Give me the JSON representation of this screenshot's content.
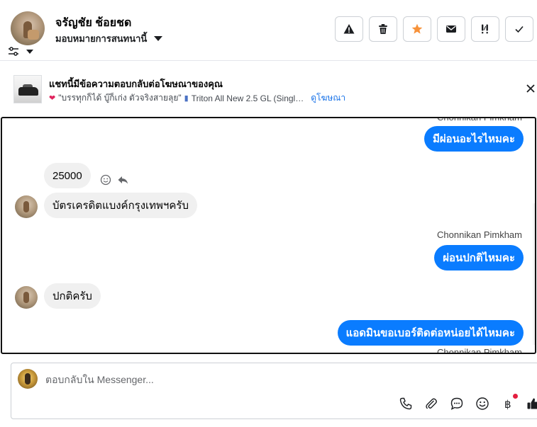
{
  "header": {
    "contact_name": "จรัญชัย ช้อยชด",
    "assign_label": "มอบหมายการสนทนานี้",
    "toolbar": {
      "spam_icon": "warning-icon",
      "delete_icon": "trash-icon",
      "star_icon": "star-icon",
      "mail_icon": "envelope-icon",
      "priority_icon": "exclamation-icon",
      "done_icon": "check-icon",
      "star_color": "#f7923a"
    }
  },
  "ad_banner": {
    "title": "แชทนี้มีข้อความตอบกลับต่อโฆษณาของคุณ",
    "quote": "\"บรรทุกก็ได้ บู๊ก็เก่ง ตัวจริงสายลุย\"",
    "product": "Triton All New 2.5 GL (Singl…",
    "view_ad_link": "ดูโฆษณา"
  },
  "conversation": {
    "top_sender_cut": "Chonnikan Pimkham",
    "messages": [
      {
        "direction": "out",
        "text": "มีผ่อนอะไรไหมคะ"
      },
      {
        "direction": "in",
        "text": "25000"
      },
      {
        "direction": "in",
        "text": "บัตรเครดิตแบงค์กรุงเทพฯครับ"
      },
      {
        "direction": "out",
        "sender": "Chonnikan Pimkham",
        "text": "ผ่อนปกติไหมคะ"
      },
      {
        "direction": "in",
        "text": "ปกติครับ"
      },
      {
        "direction": "out",
        "text": "แอดมินขอเบอร์ติดต่อหน่อยได้ไหมคะ"
      }
    ],
    "bottom_sender_cut": "Chonnikan Pimkham",
    "outgoing_color": "#0a7cff",
    "incoming_color": "#f0f0f0"
  },
  "composer": {
    "placeholder": "ตอบกลับใน Messenger...",
    "value": "",
    "tools": [
      "phone-icon",
      "paperclip-icon",
      "chat-bubble-icon",
      "emoji-icon",
      "baht-icon",
      "thumbs-up-icon"
    ]
  }
}
